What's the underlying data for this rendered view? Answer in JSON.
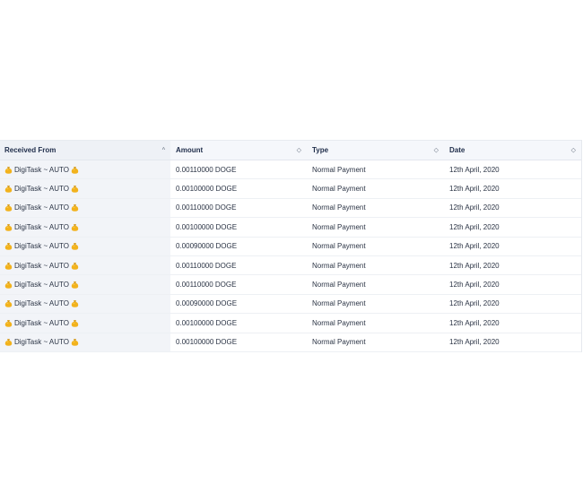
{
  "table": {
    "columns": [
      {
        "label": "Received From",
        "sort_icon": "chevron-up-icon",
        "sort_glyph": "^"
      },
      {
        "label": "Amount",
        "sort_icon": "sort-updown-icon",
        "sort_glyph": "◇"
      },
      {
        "label": "Type",
        "sort_icon": "sort-updown-icon",
        "sort_glyph": "◇"
      },
      {
        "label": "Date",
        "sort_icon": "sort-updown-icon",
        "sort_glyph": "◇"
      }
    ],
    "rows": [
      {
        "from": "DigiTask ~ AUTO",
        "amount": "0.00110000 DOGE",
        "type": "Normal Payment",
        "date": "12th April, 2020"
      },
      {
        "from": "DigiTask ~ AUTO",
        "amount": "0.00100000 DOGE",
        "type": "Normal Payment",
        "date": "12th April, 2020"
      },
      {
        "from": "DigiTask ~ AUTO",
        "amount": "0.00110000 DOGE",
        "type": "Normal Payment",
        "date": "12th April, 2020"
      },
      {
        "from": "DigiTask ~ AUTO",
        "amount": "0.00100000 DOGE",
        "type": "Normal Payment",
        "date": "12th April, 2020"
      },
      {
        "from": "DigiTask ~ AUTO",
        "amount": "0.00090000 DOGE",
        "type": "Normal Payment",
        "date": "12th April, 2020"
      },
      {
        "from": "DigiTask ~ AUTO",
        "amount": "0.00110000 DOGE",
        "type": "Normal Payment",
        "date": "12th April, 2020"
      },
      {
        "from": "DigiTask ~ AUTO",
        "amount": "0.00110000 DOGE",
        "type": "Normal Payment",
        "date": "12th April, 2020"
      },
      {
        "from": "DigiTask ~ AUTO",
        "amount": "0.00090000 DOGE",
        "type": "Normal Payment",
        "date": "12th April, 2020"
      },
      {
        "from": "DigiTask ~ AUTO",
        "amount": "0.00100000 DOGE",
        "type": "Normal Payment",
        "date": "12th April, 2020"
      },
      {
        "from": "DigiTask ~ AUTO",
        "amount": "0.00100000 DOGE",
        "type": "Normal Payment",
        "date": "12th April, 2020"
      }
    ],
    "sender_icon": "money-bag-icon",
    "colors": {
      "header_bg": "#f5f7fb",
      "first_col_bg": "#f2f4f8",
      "bag_color": "#f2b21c"
    }
  }
}
